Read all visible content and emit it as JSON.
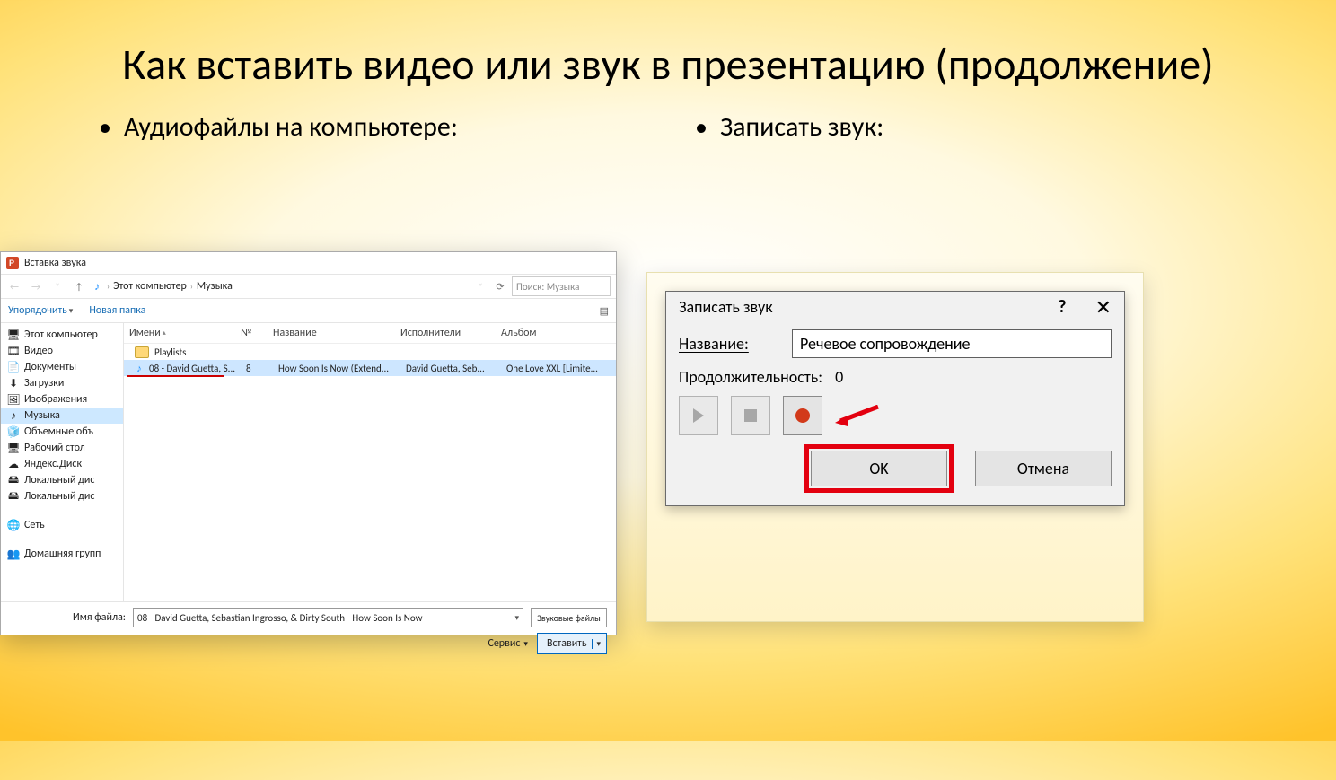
{
  "slide": {
    "title": "Как вставить видео или звук в презентацию (продолжение)",
    "bullet_left": "Аудиофайлы на компьютере:",
    "bullet_right": "Записать звук:"
  },
  "filedlg": {
    "title": "Вставка звука",
    "breadcrumb": {
      "root": "Этот компьютер",
      "folder": "Музыка"
    },
    "search_placeholder": "Поиск: Музыка",
    "toolbar": {
      "organize": "Упорядочить",
      "newfolder": "Новая папка"
    },
    "columns": {
      "name": "Имени",
      "no": "№",
      "title": "Название",
      "artist": "Исполнители",
      "album": "Альбом"
    },
    "rows": [
      {
        "kind": "folder",
        "name": "Playlists"
      },
      {
        "kind": "audio",
        "name": "08 - David Guetta, S...",
        "no": "8",
        "title": "How Soon Is Now (Extend...",
        "artist": "David Guetta, Seb...",
        "album": "One Love XXL [Limite..."
      }
    ],
    "sidebar": [
      {
        "icon": "pc",
        "label": "Этот компьютер"
      },
      {
        "icon": "video",
        "label": "Видео"
      },
      {
        "icon": "doc",
        "label": "Документы"
      },
      {
        "icon": "download",
        "label": "Загрузки"
      },
      {
        "icon": "image",
        "label": "Изображения"
      },
      {
        "icon": "music",
        "label": "Музыка",
        "selected": true
      },
      {
        "icon": "cube",
        "label": "Объемные объ"
      },
      {
        "icon": "desktop",
        "label": "Рабочий стол"
      },
      {
        "icon": "cloud",
        "label": "Яндекс.Диск"
      },
      {
        "icon": "disk",
        "label": "Локальный дис"
      },
      {
        "icon": "disk",
        "label": "Локальный дис"
      },
      {
        "icon": "net",
        "label": "Сеть",
        "spaced": true
      },
      {
        "icon": "home",
        "label": "Домашняя групп",
        "spaced": true
      }
    ],
    "footer": {
      "filename_label": "Имя файла:",
      "filename_value": "08 - David Guetta, Sebastian Ingrosso, & Dirty South - How Soon Is Now",
      "filter": "Звуковые файлы",
      "service": "Сервис",
      "insert": "Вставить"
    }
  },
  "recdlg": {
    "title": "Записать звук",
    "name_label": "Название:",
    "name_value": "Речевое сопровождение",
    "duration_label": "Продолжительность:",
    "duration_value": "0",
    "ok": "OK",
    "cancel": "Отмена"
  }
}
